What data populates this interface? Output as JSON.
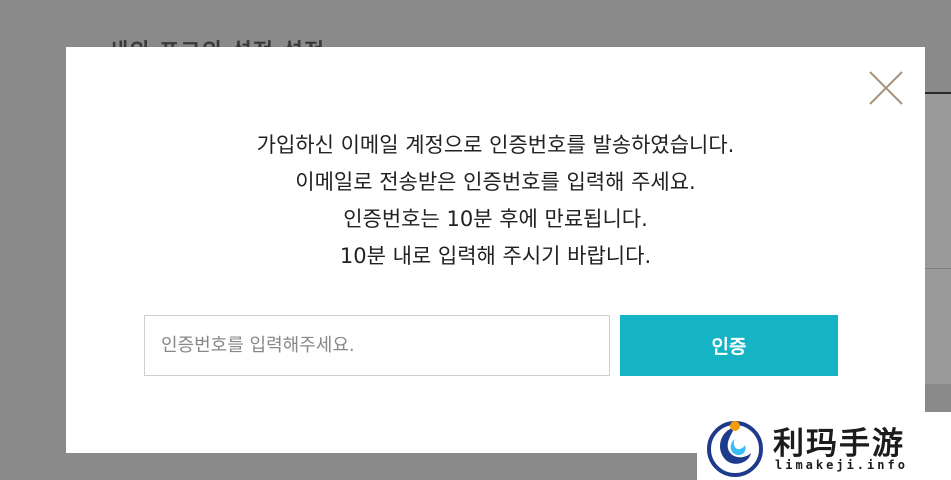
{
  "background": {
    "title": "새의 포그의 설정 설정"
  },
  "modal": {
    "message_lines": [
      "가입하신 이메일 계정으로 인증번호를 발송하였습니다.",
      "이메일로 전송받은 인증번호를 입력해 주세요.",
      "인증번호는 10분 후에 만료됩니다.",
      "10분 내로 입력해 주시기 바랍니다."
    ],
    "code_input": {
      "placeholder": "인증번호를 입력해주세요.",
      "value": ""
    },
    "verify_button_label": "인증",
    "close_icon": "close-icon",
    "accent_color": "#14b4c4"
  },
  "watermark": {
    "brand": "利玛手游",
    "url": "limakeji.info",
    "logo_icon": "swirl-logo-icon"
  }
}
